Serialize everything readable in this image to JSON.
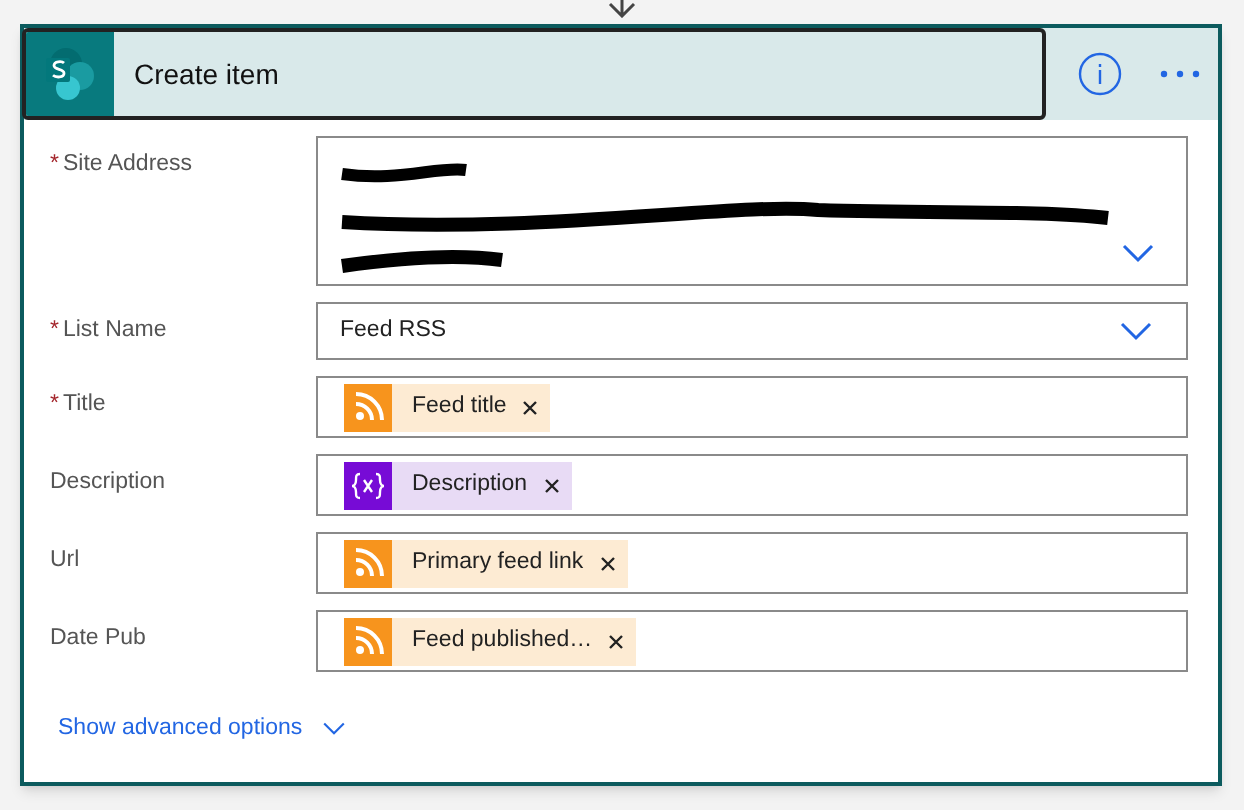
{
  "card": {
    "title": "Create item"
  },
  "fields": [
    {
      "mark": "*",
      "label": "Site Address",
      "kind": "redacted"
    },
    {
      "mark": "*",
      "label": "List Name",
      "kind": "dropdown",
      "value": "Feed RSS"
    },
    {
      "mark": "*",
      "label": "Title",
      "kind": "tokens",
      "tokens": [
        {
          "kind": "rss",
          "label": "Feed title"
        }
      ]
    },
    {
      "label": "Description",
      "kind": "tokens",
      "tokens": [
        {
          "kind": "variable",
          "label": "Description"
        }
      ]
    },
    {
      "label": "Url",
      "kind": "tokens",
      "tokens": [
        {
          "kind": "rss",
          "label": "Primary feed link"
        }
      ]
    },
    {
      "label": "Date Pub",
      "kind": "tokens",
      "tokens": [
        {
          "kind": "rss",
          "label": "Feed published…"
        }
      ]
    }
  ],
  "advanced_link": "Show advanced options"
}
